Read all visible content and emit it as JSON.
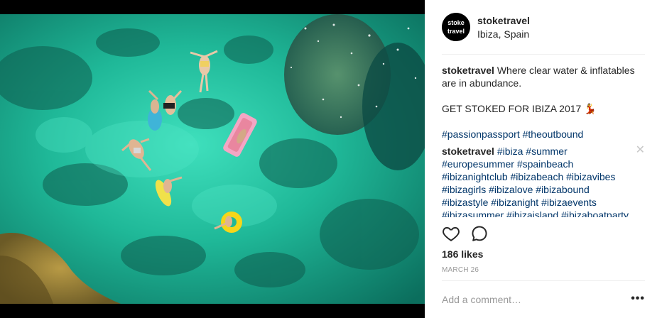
{
  "post": {
    "username": "stoketravel",
    "location": "Ibiza, Spain",
    "avatar_text_top": "stoke",
    "avatar_text_bottom": "travel"
  },
  "caption": {
    "user": "stoketravel",
    "text": "Where clear water & inflatables are in abundance.",
    "line2": "GET STOKED FOR IBIZA 2017 💃",
    "hashtags": "#passionpassport #theoutbound"
  },
  "comment": {
    "user": "stoketravel",
    "hashtags": "#ibiza #summer #europesummer #spainbeach #ibizanightclub #ibizabeach #ibizavibes #ibizagirls #ibizalove #ibizabound #ibizastyle #ibizanight #ibizaevents #ibizasummer #ibizaisland #ibizaboatparty",
    "close_symbol": "✕"
  },
  "stats": {
    "likes": "186 likes",
    "date": "MARCH 26"
  },
  "add_comment": {
    "placeholder": "Add a comment…"
  },
  "more_symbol": "•••",
  "icons": {
    "like": "heart-icon",
    "comment": "speech-bubble-icon"
  },
  "colors": {
    "water_light": "#2fd3b0",
    "water_dark": "#0a6c5c",
    "hashtag": "#003569",
    "muted": "#999999"
  }
}
